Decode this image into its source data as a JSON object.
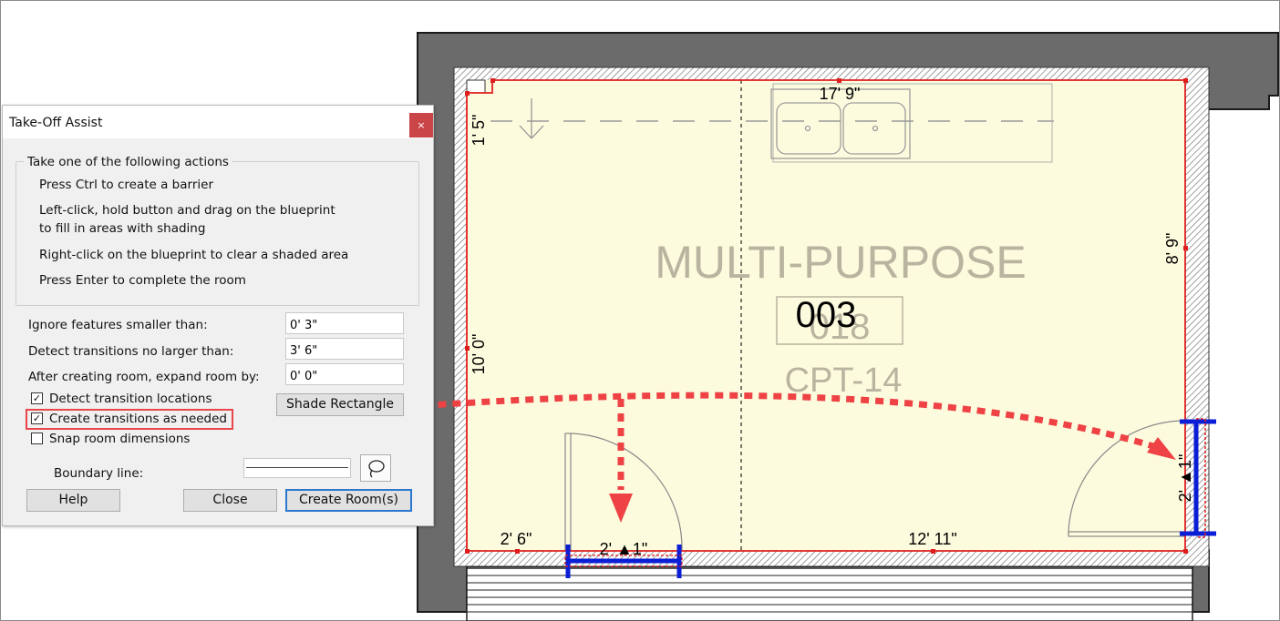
{
  "dialog": {
    "title": "Take-Off Assist",
    "close_glyph": "×",
    "group_title": "Take one of the following actions",
    "instructions": [
      "Press Ctrl to create a barrier",
      "Left-click, hold button and drag on the blueprint",
      "to fill in areas with shading",
      "Right-click on the blueprint to clear a shaded area",
      "Press Enter to complete the room"
    ],
    "fields": [
      {
        "label": "Ignore features smaller than:",
        "value": "0' 3\""
      },
      {
        "label": "Detect transitions no larger than:",
        "value": "3' 6\""
      },
      {
        "label": "After creating room, expand room by:",
        "value": "0' 0\""
      }
    ],
    "checkboxes": [
      {
        "label": "Detect transition locations",
        "checked": true,
        "mark": "✓"
      },
      {
        "label": "Create transitions as needed",
        "checked": true,
        "mark": "✓"
      },
      {
        "label": "Snap room dimensions",
        "checked": false,
        "mark": ""
      }
    ],
    "shade_rectangle_label": "Shade Rectangle",
    "boundary_line_label": "Boundary line:",
    "buttons": {
      "help": "Help",
      "close": "Close",
      "create": "Create Room(s)"
    }
  },
  "blueprint": {
    "room_name": "MULTI-PURPOSE",
    "room_number_overlay": "003",
    "room_number_faded": "018",
    "room_code": "CPT-14",
    "dimensions": {
      "top": "17' 9\"",
      "left_top": "1' 5\"",
      "right": "8' 9\"",
      "left": "10' 0\"",
      "bottom_left": "2' 6\"",
      "bottom_door": "2' ▲1\"",
      "bottom_right": "12' 11\"",
      "right_door": "2' ▲1\""
    }
  },
  "colors": {
    "room_fill": "#fdfbdd",
    "wall": "#6e6e6e",
    "boundary": "#e01d1d",
    "transition": "#0a1ed6",
    "annotation_arrow": "#ee4245",
    "faded_text": "#b8b4a0"
  }
}
